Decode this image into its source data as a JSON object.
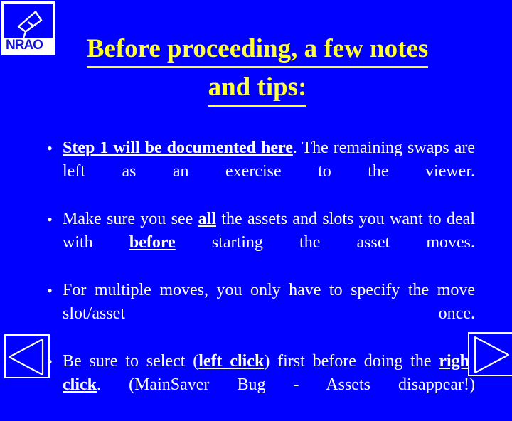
{
  "slide": {
    "background_color": "#0000FF",
    "title_color": "#FFFF33",
    "body_color": "#FFFFFF"
  },
  "logo": {
    "name": "NRAO",
    "wordmark": "NRAO",
    "icon": "radio-telescope-dish-icon"
  },
  "title": {
    "line1": "Before proceeding, a few notes",
    "line2": "and tips:"
  },
  "body": {
    "bullet_marker": "•",
    "bullets": [
      {
        "parts": [
          {
            "text": "Step 1 will  be documented here",
            "emphasis": true
          },
          {
            "text": ". The remaining swaps are left as an exercise to the viewer.",
            "emphasis": false
          }
        ]
      },
      {
        "parts": [
          {
            "text": "Make sure you see ",
            "emphasis": false
          },
          {
            "text": "all",
            "emphasis": true
          },
          {
            "text": " the assets and slots you want to deal with ",
            "emphasis": false
          },
          {
            "text": "before",
            "emphasis": true
          },
          {
            "text": " starting the asset moves.",
            "emphasis": false
          }
        ]
      },
      {
        "parts": [
          {
            "text": "For multiple moves, you only have to specify the move slot/asset once.",
            "emphasis": false
          }
        ]
      },
      {
        "parts": [
          {
            "text": "Be sure to select (",
            "emphasis": false
          },
          {
            "text": "left click",
            "emphasis": true
          },
          {
            "text": ") first before doing the ",
            "emphasis": false
          },
          {
            "text": "right click",
            "emphasis": true
          },
          {
            "text": ". (MainSaver Bug - Assets disappear!)",
            "emphasis": false
          }
        ]
      }
    ]
  },
  "navigation": {
    "previous_label": "previous-slide",
    "next_label": "next-slide",
    "previous_icon": "triangle-left-icon",
    "next_icon": "triangle-right-icon"
  }
}
